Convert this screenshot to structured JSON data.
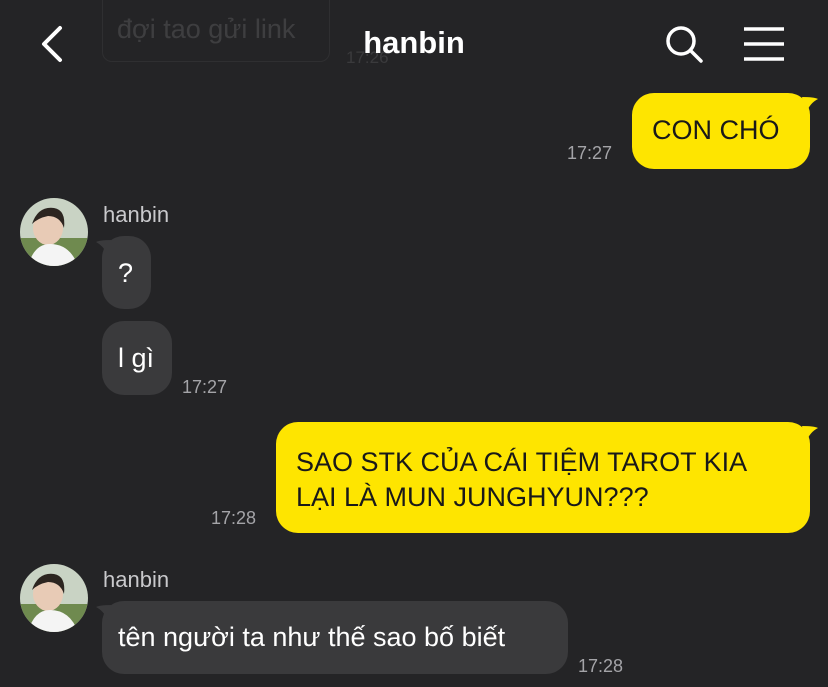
{
  "header": {
    "title": "hanbin",
    "back_icon": "chevron-left-icon",
    "search_icon": "search-icon",
    "menu_icon": "hamburger-menu-icon"
  },
  "ghost": {
    "text": "đợi tao gửi link",
    "time": "17:26"
  },
  "messages": [
    {
      "from": "me",
      "text": "CON CHÓ",
      "time": "17:27"
    },
    {
      "from": "hanbin",
      "sender": "hanbin",
      "texts": [
        "?",
        "l gì"
      ],
      "time": "17:27"
    },
    {
      "from": "me",
      "lines": [
        "SAO STK CỦA CÁI TIỆM TAROT KIA",
        "LẠI LÀ MUN JUNGHYUN???"
      ],
      "time": "17:28"
    },
    {
      "from": "hanbin",
      "sender": "hanbin",
      "texts": [
        "tên người ta như thế sao bố biết"
      ],
      "time": "17:28"
    }
  ],
  "colors": {
    "background": "#242426",
    "outgoing_bubble": "#fee500",
    "incoming_bubble": "#3a3a3c",
    "time_text": "#a4a4a8"
  }
}
